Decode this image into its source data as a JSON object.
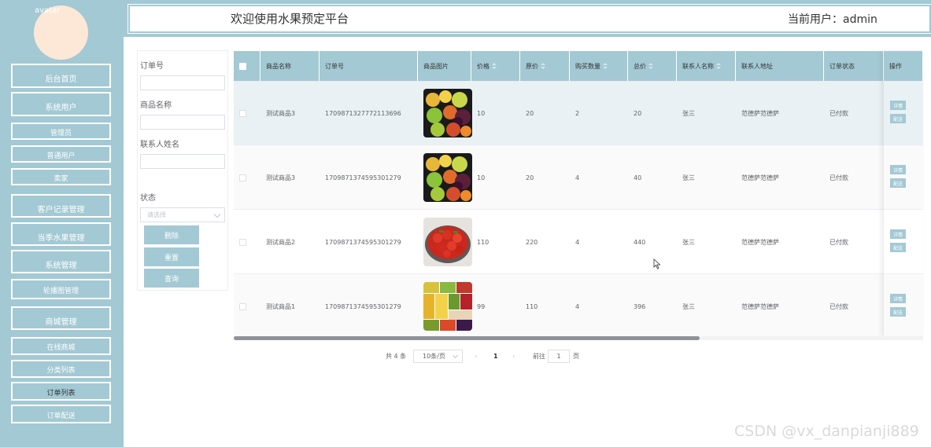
{
  "sidebar": {
    "avatar_alt": "avatar",
    "items": [
      {
        "label": "后台首页"
      },
      {
        "label": "系统用户"
      },
      {
        "label": "管理员"
      },
      {
        "label": "普通用户"
      },
      {
        "label": "卖家"
      },
      {
        "label": "客户记录管理"
      },
      {
        "label": "当季水果管理"
      },
      {
        "label": "系统管理"
      },
      {
        "label": "轮播图管理"
      },
      {
        "label": "商城管理"
      },
      {
        "label": "在线商城"
      },
      {
        "label": "分类列表"
      },
      {
        "label": "订单列表"
      },
      {
        "label": "订单配送"
      }
    ],
    "accent_color": "#a3c9d4"
  },
  "header": {
    "title": "欢迎使用水果预定平台",
    "current_user": "当前用户：admin"
  },
  "search": {
    "order_no_label": "订单号",
    "product_name_label": "商品名称",
    "contact_name_label": "联系人姓名",
    "status_label": "状态",
    "status_placeholder": "请选择",
    "delete_btn": "删除",
    "reset_btn": "重置",
    "query_btn": "查询"
  },
  "table": {
    "columns": [
      "商品名称",
      "订单号",
      "商品图片",
      "价格",
      "原价",
      "购买数量",
      "总价",
      "联系人名称",
      "联系人地址",
      "订单状态",
      "操作"
    ],
    "detail_btn": "详情",
    "deliver_btn": "配送",
    "rows": [
      {
        "name": "测试商品3",
        "order_no": "1709871327772113696",
        "image": "mixed-fruit",
        "price": "10",
        "original_price": "20",
        "qty": "2",
        "total": "20",
        "contact": "张三",
        "address": "范德萨范德萨",
        "status": "已付款"
      },
      {
        "name": "测试商品3",
        "order_no": "1709871374595301279",
        "image": "mixed-fruit",
        "price": "10",
        "original_price": "20",
        "qty": "4",
        "total": "40",
        "contact": "张三",
        "address": "范德萨范德萨",
        "status": "已付款"
      },
      {
        "name": "测试商品2",
        "order_no": "1709871374595301279",
        "image": "strawberries",
        "price": "110",
        "original_price": "220",
        "qty": "4",
        "total": "440",
        "contact": "张三",
        "address": "范德萨范德萨",
        "status": "已付款"
      },
      {
        "name": "测试商品1",
        "order_no": "1709871374595301279",
        "image": "fruit-collage",
        "price": "99",
        "original_price": "110",
        "qty": "4",
        "total": "396",
        "contact": "张三",
        "address": "范德萨范德萨",
        "status": "已付款"
      }
    ]
  },
  "pagination": {
    "total": "共 4 条",
    "page_size": "10条/页",
    "current_page": "1",
    "goto_label": "前往",
    "goto_value": "1",
    "page_suffix": "页"
  },
  "watermark": "CSDN @vx_danpianji889"
}
